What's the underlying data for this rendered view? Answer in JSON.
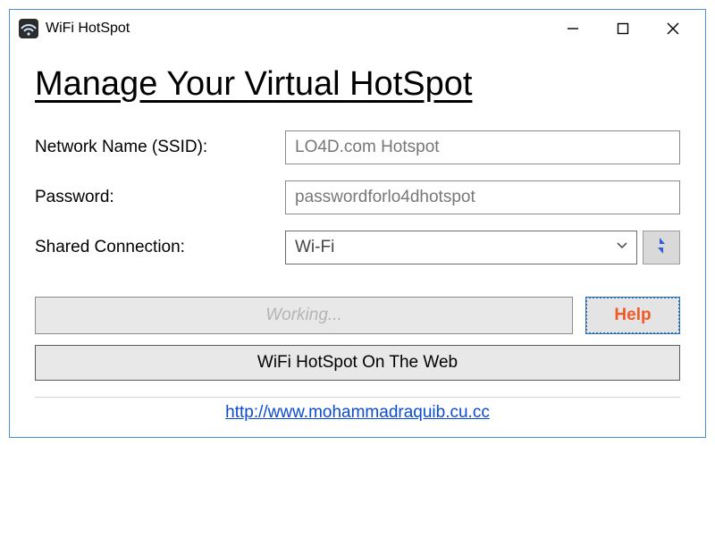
{
  "titlebar": {
    "title": "WiFi HotSpot"
  },
  "heading": "Manage Your Virtual HotSpot",
  "fields": {
    "ssid_label": "Network Name (SSID):",
    "ssid_value": "LO4D.com Hotspot",
    "password_label": "Password:",
    "password_value": "passwordforlo4dhotspot",
    "shared_label": "Shared Connection:",
    "shared_value": "Wi-Fi"
  },
  "buttons": {
    "working": "Working...",
    "help": "Help",
    "web": "WiFi HotSpot On The Web"
  },
  "link": "http://www.mohammadraquib.cu.cc"
}
